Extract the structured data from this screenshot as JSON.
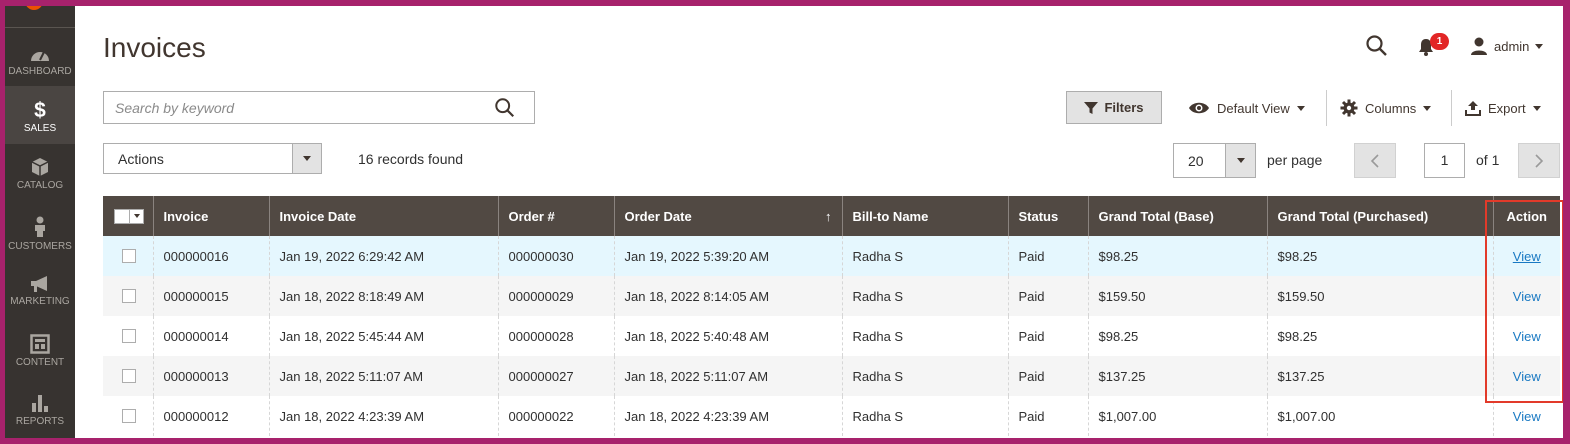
{
  "sidebar": {
    "items": [
      {
        "label": "DASHBOARD",
        "icon": "dashboard-icon"
      },
      {
        "label": "SALES",
        "icon": "dollar-icon"
      },
      {
        "label": "CATALOG",
        "icon": "cube-icon"
      },
      {
        "label": "CUSTOMERS",
        "icon": "person-icon"
      },
      {
        "label": "MARKETING",
        "icon": "megaphone-icon"
      },
      {
        "label": "CONTENT",
        "icon": "layout-icon"
      },
      {
        "label": "REPORTS",
        "icon": "bar-chart-icon"
      }
    ],
    "active": "SALES"
  },
  "header": {
    "title": "Invoices",
    "notification_count": "1",
    "user": "admin"
  },
  "search": {
    "placeholder": "Search by keyword"
  },
  "toolbar": {
    "filters_label": "Filters",
    "view_label": "Default View",
    "columns_label": "Columns",
    "export_label": "Export"
  },
  "actions": {
    "label": "Actions",
    "records_found": "16 records found"
  },
  "pagination": {
    "per_page_value": "20",
    "per_page_label": "per page",
    "current_page": "1",
    "of_label": "of 1"
  },
  "table": {
    "columns": [
      "Invoice",
      "Invoice Date",
      "Order #",
      "Order Date",
      "Bill-to Name",
      "Status",
      "Grand Total (Base)",
      "Grand Total (Purchased)",
      "Action"
    ],
    "sort_indicator": "↑",
    "rows": [
      {
        "invoice": "000000016",
        "invoice_date": "Jan 19, 2022 6:29:42 AM",
        "order": "000000030",
        "order_date": "Jan 19, 2022 5:39:20 AM",
        "bill_to": "Radha S",
        "status": "Paid",
        "total_base": "$98.25",
        "total_purchased": "$98.25",
        "action": "View"
      },
      {
        "invoice": "000000015",
        "invoice_date": "Jan 18, 2022 8:18:49 AM",
        "order": "000000029",
        "order_date": "Jan 18, 2022 8:14:05 AM",
        "bill_to": "Radha S",
        "status": "Paid",
        "total_base": "$159.50",
        "total_purchased": "$159.50",
        "action": "View"
      },
      {
        "invoice": "000000014",
        "invoice_date": "Jan 18, 2022 5:45:44 AM",
        "order": "000000028",
        "order_date": "Jan 18, 2022 5:40:48 AM",
        "bill_to": "Radha S",
        "status": "Paid",
        "total_base": "$98.25",
        "total_purchased": "$98.25",
        "action": "View"
      },
      {
        "invoice": "000000013",
        "invoice_date": "Jan 18, 2022 5:11:07 AM",
        "order": "000000027",
        "order_date": "Jan 18, 2022 5:11:07 AM",
        "bill_to": "Radha S",
        "status": "Paid",
        "total_base": "$137.25",
        "total_purchased": "$137.25",
        "action": "View"
      },
      {
        "invoice": "000000012",
        "invoice_date": "Jan 18, 2022 4:23:39 AM",
        "order": "000000022",
        "order_date": "Jan 18, 2022 4:23:39 AM",
        "bill_to": "Radha S",
        "status": "Paid",
        "total_base": "$1,007.00",
        "total_purchased": "$1,007.00",
        "action": "View"
      }
    ]
  },
  "colors": {
    "frame": "#a7226c",
    "sidebar": "#373330",
    "table_header": "#514943",
    "link": "#1979c3",
    "highlight": "#e23a2a",
    "accent": "#eb5202"
  }
}
